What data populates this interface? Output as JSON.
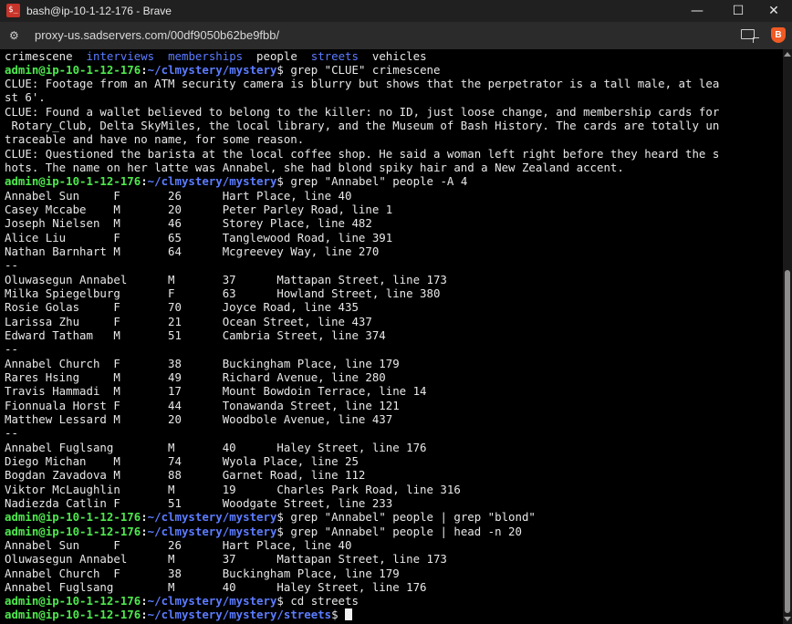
{
  "window": {
    "app_icon_text": "$_",
    "title": "bash@ip-10-1-12-176 - Brave",
    "minimize_glyph": "—",
    "maximize_glyph": "☐",
    "close_glyph": "✕"
  },
  "browser": {
    "site_icon": "⚙",
    "url": "proxy-us.sadservers.com/00df9050b62be9fbb/",
    "cast_icon": "cast-icon",
    "brave_icon_text": "B"
  },
  "terminal": {
    "prompt_user": "admin@ip-10-1-12-176",
    "prompt_sep": ":",
    "prompt_path": "~/clmystery/mystery",
    "prompt_path_streets": "~/clmystery/mystery/streets",
    "prompt_end": "$ ",
    "ls_items": [
      "crimescene",
      "interviews",
      "memberships",
      "people",
      "streets",
      "vehicles"
    ],
    "commands": {
      "cmd1": "grep \"CLUE\" crimescene",
      "cmd2": "grep \"Annabel\" people -A 4",
      "cmd3": "grep \"Annabel\" people | grep \"blond\"",
      "cmd4": "grep \"Annabel\" people | head -n 20",
      "cmd5": "cd streets"
    },
    "clue_lines": [
      "CLUE: Footage from an ATM security camera is blurry but shows that the perpetrator is a tall male, at lea",
      "st 6'.",
      "CLUE: Found a wallet believed to belong to the killer: no ID, just loose change, and membership cards for",
      " Rotary_Club, Delta SkyMiles, the local library, and the Museum of Bash History. The cards are totally un",
      "traceable and have no name, for some reason.",
      "CLUE: Questioned the barista at the local coffee shop. He said a woman left right before they heard the s",
      "hots. The name on her latte was Annabel, she had blond spiky hair and a New Zealand accent."
    ],
    "grep_a4_lines": [
      "Annabel Sun     F       26      Hart Place, line 40",
      "Casey Mccabe    M       20      Peter Parley Road, line 1",
      "Joseph Nielsen  M       46      Storey Place, line 482",
      "Alice Liu       F       65      Tanglewood Road, line 391",
      "Nathan Barnhart M       64      Mcgreevey Way, line 270",
      "--",
      "Oluwasegun Annabel      M       37      Mattapan Street, line 173",
      "Milka Spiegelburg       F       63      Howland Street, line 380",
      "Rosie Golas     F       70      Joyce Road, line 435",
      "Larissa Zhu     F       21      Ocean Street, line 437",
      "Edward Tatham   M       51      Cambria Street, line 374",
      "--",
      "Annabel Church  F       38      Buckingham Place, line 179",
      "Rares Hsing     M       49      Richard Avenue, line 280",
      "Travis Hammadi  M       17      Mount Bowdoin Terrace, line 14",
      "Fionnuala Horst F       44      Tonawanda Street, line 121",
      "Matthew Lessard M       20      Woodbole Avenue, line 437",
      "--",
      "Annabel Fuglsang        M       40      Haley Street, line 176",
      "Diego Michan    M       74      Wyola Place, line 25",
      "Bogdan Zavadova M       88      Garnet Road, line 112",
      "Viktor McLaughlin       M       19      Charles Park Road, line 316",
      "Nadiezda Catlin F       51      Woodgate Street, line 233"
    ],
    "head_lines": [
      "Annabel Sun     F       26      Hart Place, line 40",
      "Oluwasegun Annabel      M       37      Mattapan Street, line 173",
      "Annabel Church  F       38      Buckingham Place, line 179",
      "Annabel Fuglsang        M       40      Haley Street, line 176"
    ]
  }
}
